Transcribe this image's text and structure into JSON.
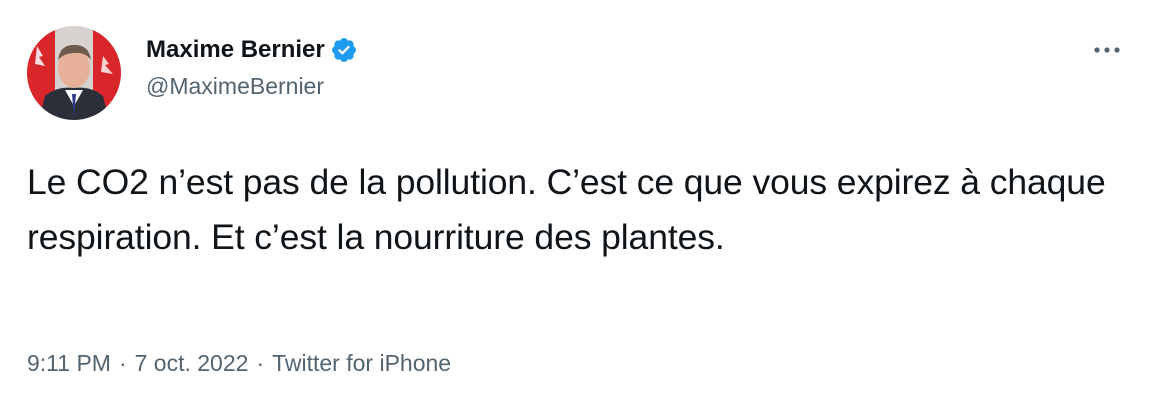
{
  "author": {
    "display_name": "Maxime Bernier",
    "handle": "@MaximeBernier",
    "verified_icon": "verified-badge-icon",
    "avatar_icon": "profile-photo"
  },
  "tweet": {
    "text": "Le CO2 n’est pas de la pollution. C’est ce que vous expirez à chaque respiration. Et c’est la nourriture des plantes."
  },
  "meta": {
    "time": "9:11 PM",
    "date": "7 oct. 2022",
    "source": "Twitter for iPhone",
    "separator": "·"
  },
  "actions": {
    "more_icon": "more-options-icon"
  },
  "colors": {
    "text": "#0f1419",
    "secondary": "#536471",
    "verified": "#1d9bf0"
  }
}
